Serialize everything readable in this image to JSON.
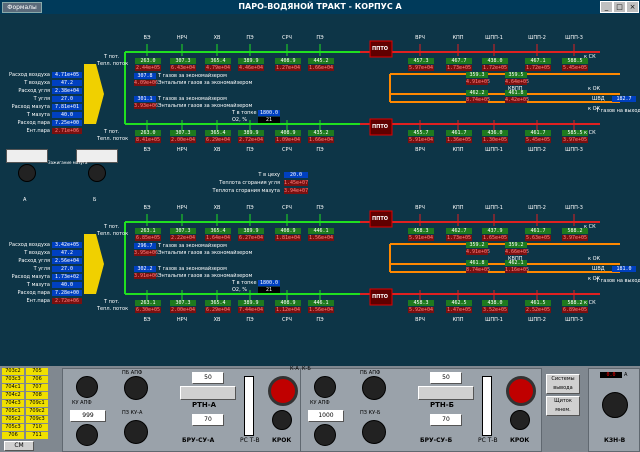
{
  "window": {
    "menu_label": "Формалы",
    "title": "ПАРО-ВОДЯНОЙ ТРАКТ - КОРПУС А"
  },
  "sections": [
    "ВЭ",
    "НРЧ",
    "ХВ",
    "ПЭ",
    "СРЧ",
    "ПЭ",
    "ВРЧ",
    "КПП",
    "ШПП-1",
    "ШПП-2",
    "ШПП-3"
  ],
  "row_labels": {
    "t_pot": "Т пот.",
    "t_potok": "Тепл. поток",
    "to_out": "Т газов на выходе"
  },
  "ab": {
    "a": "А",
    "b": "Б"
  },
  "side_params_top": [
    {
      "label": "Расход воздуха",
      "value": "4.71e+05",
      "cls": "b"
    },
    {
      "label": "Т воздуха",
      "value": "47.2",
      "cls": "b"
    },
    {
      "label": "Расход угля",
      "value": "2.38e+04",
      "cls": "b"
    },
    {
      "label": "Т угля",
      "value": "27.0",
      "cls": "b"
    },
    {
      "label": "Расход мазута",
      "value": "7.81e+01",
      "cls": "b"
    },
    {
      "label": "Т мазута",
      "value": "40.0",
      "cls": "b"
    },
    {
      "label": "Расход пара",
      "value": "7.25e+00",
      "cls": "b"
    },
    {
      "label": "Ент.пара",
      "value": "2.71e+06",
      "cls": "r"
    }
  ],
  "side_params_bot": [
    {
      "label": "Расход воздуха",
      "value": "3.42e+05",
      "cls": "b"
    },
    {
      "label": "Т воздуха",
      "value": "47.2",
      "cls": "b"
    },
    {
      "label": "Расход угля",
      "value": "2.56e+04",
      "cls": "b"
    },
    {
      "label": "Т угля",
      "value": "27.0",
      "cls": "b"
    },
    {
      "label": "Расход мазута",
      "value": "1.73e+02",
      "cls": "b"
    },
    {
      "label": "Т мазута",
      "value": "40.0",
      "cls": "b"
    },
    {
      "label": "Расход пара",
      "value": "7.28e+00",
      "cls": "b"
    },
    {
      "label": "Ент.пара",
      "value": "2.72e+06",
      "cls": "r"
    }
  ],
  "top_row1": [
    {
      "t": "263.0",
      "q": "2.44e+05"
    },
    {
      "t": "307.3",
      "q": "6.43e+04"
    },
    {
      "t": "365.4",
      "q": "4.79e+04"
    },
    {
      "t": "389.9",
      "q": "4.46e+04"
    },
    {
      "t": "408.9",
      "q": "1.27e+04"
    },
    {
      "t": "445.2",
      "q": "1.66e+04"
    },
    {
      "t": "457.3",
      "q": "5.97e+04"
    },
    {
      "t": "467.7",
      "q": "1.73e+05"
    },
    {
      "t": "438.0",
      "q": "1.72e+05"
    },
    {
      "t": "467.1",
      "q": "1.72e+05"
    },
    {
      "t": "588.5",
      "q": "5.45e+05"
    }
  ],
  "top_row2": [
    {
      "t": "263.0",
      "q": "8.41e+05"
    },
    {
      "t": "307.3",
      "q": "2.00e+04"
    },
    {
      "t": "365.4",
      "q": "6.29e+04"
    },
    {
      "t": "389.9",
      "q": "2.72e+04"
    },
    {
      "t": "408.9",
      "q": "1.09e+04"
    },
    {
      "t": "435.2",
      "q": "1.66e+04"
    },
    {
      "t": "455.7",
      "q": "5.91e+04"
    },
    {
      "t": "461.7",
      "q": "1.36e+05"
    },
    {
      "t": "436.0",
      "q": "1.30e+05"
    },
    {
      "t": "461.7",
      "q": "5.45e+05"
    },
    {
      "t": "585.5",
      "q": "3.97e+05"
    }
  ],
  "bot_row1": [
    {
      "t": "263.1",
      "q": "6.85e+05"
    },
    {
      "t": "307.3",
      "q": "2.22e+04"
    },
    {
      "t": "365.4",
      "q": "1.64e+04"
    },
    {
      "t": "389.9",
      "q": "6.27e+04"
    },
    {
      "t": "408.9",
      "q": "1.81e+04"
    },
    {
      "t": "446.1",
      "q": "1.56e+04"
    },
    {
      "t": "458.3",
      "q": "5.91e+04"
    },
    {
      "t": "462.7",
      "q": "1.73e+05"
    },
    {
      "t": "437.9",
      "q": "1.65e+05"
    },
    {
      "t": "461.7",
      "q": "5.63e+05"
    },
    {
      "t": "588.2",
      "q": "3.97e+05"
    }
  ],
  "bot_row2": [
    {
      "t": "263.1",
      "q": "6.30e+05"
    },
    {
      "t": "307.3",
      "q": "2.00e+04"
    },
    {
      "t": "365.4",
      "q": "6.29e+04"
    },
    {
      "t": "389.9",
      "q": "7.44e+04"
    },
    {
      "t": "408.9",
      "q": "1.12e+04"
    },
    {
      "t": "446.1",
      "q": "1.56e+04"
    },
    {
      "t": "458.3",
      "q": "5.92e+04"
    },
    {
      "t": "462.5",
      "q": "1.47e+05"
    },
    {
      "t": "438.0",
      "q": "3.52e+05"
    },
    {
      "t": "461.5",
      "q": "2.52e+05"
    },
    {
      "t": "588.2",
      "q": "6.89e+05"
    }
  ],
  "top_info": {
    "l1": "Т газов за экономайзером",
    "v1": "307.8",
    "l2": "Энтальпия газов за экономайзером",
    "v2": "4.09e+06",
    "l3": "Т газов за экономайзером",
    "v3": "301.1",
    "l4": "Энтальпия газов за экономайзером",
    "v4": "3.93e+06",
    "tf_l": "Т в топке",
    "tf_v": "1800.0",
    "o2_l": "O2, %",
    "o2_v": "21"
  },
  "bot_info": {
    "l1": "Т газов за экономайзером",
    "v1": "296.7",
    "l2": "Энтальпия газов за экономайзером",
    "v2": "3.95e+06",
    "l3": "Т газов за экономайзером",
    "v3": "302.2",
    "l4": "Энтальпия газов за экономайзером",
    "v4": "3.91e+06",
    "tf_l": "Т в топке",
    "tf_v": "1800.0",
    "o2_l": "O2, %",
    "o2_v": "21"
  },
  "mid_info": [
    {
      "label": "Т в цеху",
      "value": "20.0",
      "cls": "b"
    },
    {
      "label": "Теплота сгорания угля",
      "value": "1.45e+07",
      "cls": "r"
    },
    {
      "label": "Теплота сгорания мазута",
      "value": "3.94e+07",
      "cls": "r"
    }
  ],
  "out_top": "182.7",
  "out_bot": "181.0",
  "ppto": "ППТО",
  "kpp_vals_top": [
    {
      "t": "359.3",
      "q": "4.91e+05"
    },
    {
      "t": "359.5",
      "q": "4.64e+05"
    },
    {
      "t": "462.2",
      "q": "8.74e+05"
    },
    {
      "t": "461.8",
      "q": "4.42e+05"
    }
  ],
  "kpp_vals_bot": [
    {
      "t": "359.2",
      "q": "4.91e+05"
    },
    {
      "t": "359.2",
      "q": "4.66e+05"
    },
    {
      "t": "461.8",
      "q": "8.74e+05"
    },
    {
      "t": "462.1",
      "q": "1.16e+05"
    }
  ],
  "kpp_label": "КВПП",
  "ksk_labels": [
    "к СК",
    "к СК",
    "к СК",
    "к СК"
  ],
  "kok_labels": [
    "к ОК",
    "к ОК",
    "к ОК",
    "к ОК"
  ],
  "shvd": "ШВД",
  "kpp": "КПП",
  "gauge_label": "Зажигание мазута",
  "bottom": {
    "ka_label": "К-А",
    "kb_label": "К-Б",
    "rtn_a": "РТН-А",
    "rtn_b": "РТН-Б",
    "bru_a": "БРУ-СУ-А",
    "bru_b": "БРУ-СУ-Б",
    "rc_tv": "РС Т-В",
    "krok": "КРОК",
    "val_50a": "50",
    "val_70a": "70",
    "val_50b": "50",
    "val_70b": "70",
    "val_999": "999",
    "val_1000": "1000",
    "ku_apf_a": "КУ АПФ",
    "ku_apf_b": "КУ АПФ",
    "pz_apf": "ПЗ КУ-А",
    "pz_bpf": "ПЗ КУ-Б",
    "pb_apf": "ПБ АПФ",
    "pb_bpf": "ПБ АПФ",
    "sys_btn": "Системы вывода",
    "flame_btn": "Щиток мнем.",
    "kzn": "КЗН-В",
    "right_val": "0.0",
    "right_a": "А",
    "sm": "СМ"
  },
  "left_table": [
    [
      "703c2",
      "705"
    ],
    [
      "703c3",
      "706"
    ],
    [
      "704c1",
      "707"
    ],
    [
      "704c2",
      "708"
    ],
    [
      "704c3",
      "709c1"
    ],
    [
      "705c1",
      "709c2"
    ],
    [
      "705c2",
      "709c3"
    ],
    [
      "705c3",
      "710"
    ],
    [
      "706",
      "711"
    ]
  ]
}
